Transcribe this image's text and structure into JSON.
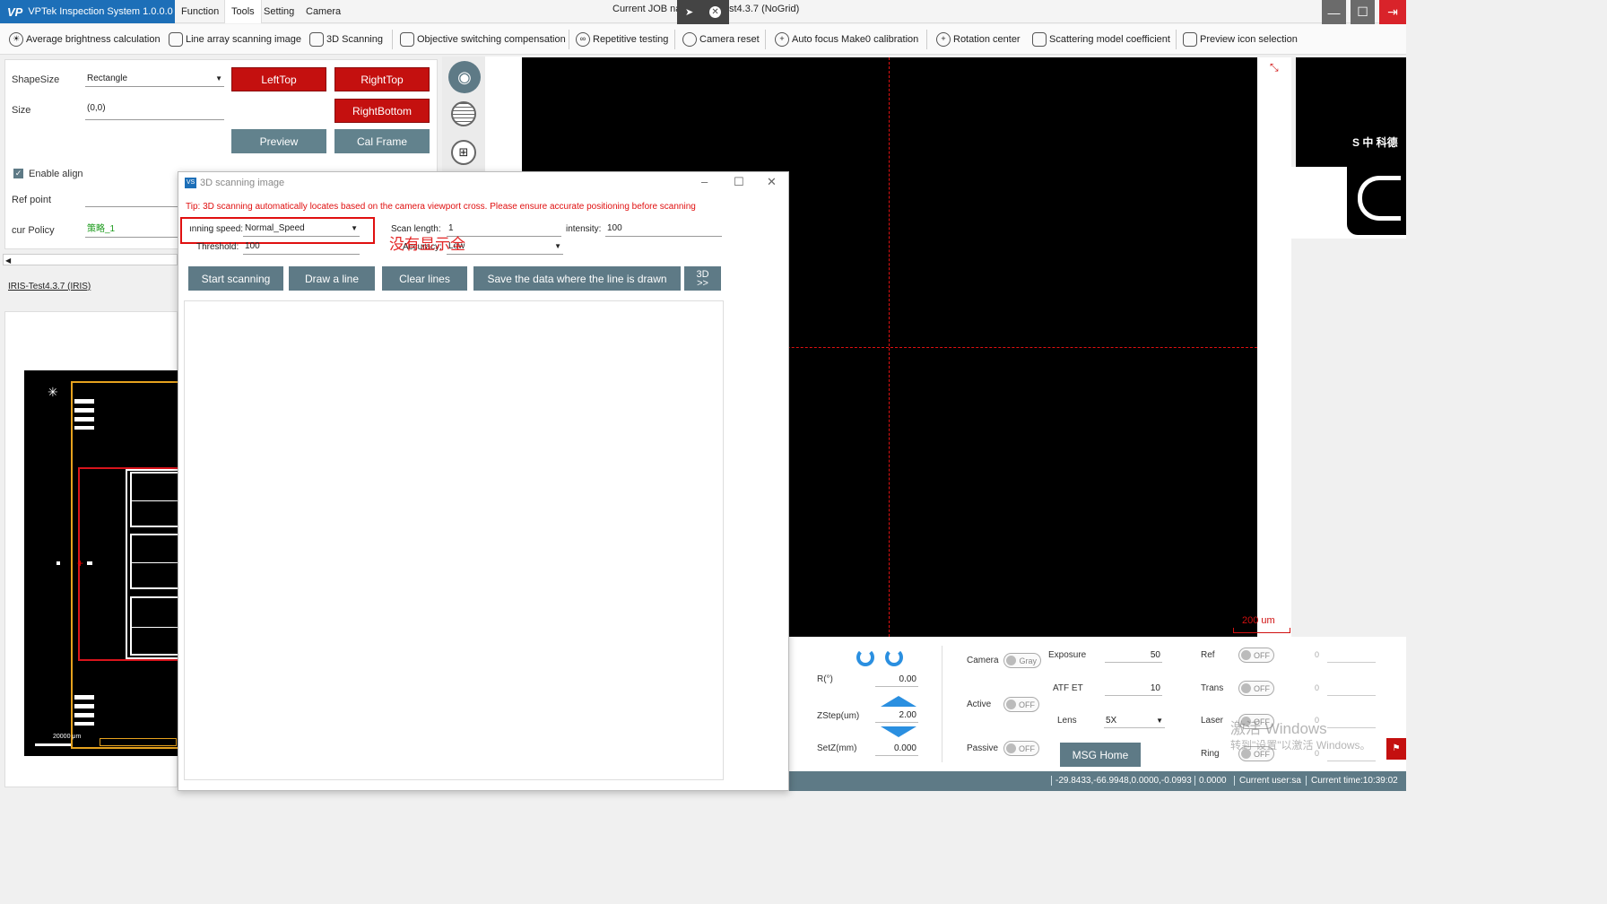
{
  "app": {
    "logo": "VP",
    "title": "VPTek Inspection System 1.0.0.0",
    "job_prefix": "Current JOB na",
    "job_suffix": "st4.3.7 (NoGrid)"
  },
  "menus": [
    "Function",
    "Tools",
    "Setting",
    "Camera"
  ],
  "toolbar": [
    "Average brightness calculation",
    "Line array scanning image",
    "3D Scanning",
    "Objective switching compensation",
    "Repetitive testing",
    "Camera reset",
    "Auto focus Make0 calibration",
    "Rotation center",
    "Scattering model coefficient",
    "Preview icon selection"
  ],
  "left": {
    "shape_label": "ShapeSize",
    "shape_value": "Rectangle",
    "size_label": "Size",
    "size_value": "(0,0)",
    "enable_align": "Enable align",
    "ref_point": "Ref point",
    "cur_policy": "cur Policy",
    "cur_policy_value": "策略_1",
    "iris_link": "IRIS-Test4.3.7 (IRIS)",
    "btn_lefttop": "LeftTop",
    "btn_righttop": "RightTop",
    "btn_rightbottom": "RightBottom",
    "btn_preview": "Preview",
    "btn_calframe": "Cal Frame",
    "map_scale": "20000 μm"
  },
  "dialog": {
    "title": "3D scanning image",
    "tip": "Tip: 3D scanning automatically locates based on the camera viewport cross. Please ensure accurate positioning before scanning",
    "speed_label": "ınning speed:",
    "speed_value": "Normal_Speed",
    "scan_length_label": "Scan length:",
    "scan_length_value": "1",
    "intensity_label": "intensity:",
    "intensity_value": "100",
    "threshold_label": "Threshold:",
    "threshold_value": "100",
    "accuracy_label": "Accuracy:",
    "accuracy_value": "Low",
    "annotation": "没有显示全",
    "btn_start": "Start scanning",
    "btn_draw": "Draw a line",
    "btn_clear": "Clear lines",
    "btn_save": "Save the data where the line is drawn",
    "btn_3d": "3D >>"
  },
  "viewer": {
    "scale": "200 um",
    "logo_text": "S 中 科德"
  },
  "controls": {
    "r_label": "R(°)",
    "r_value": "0.00",
    "zstep_label": "ZStep(um)",
    "zstep_value": "2.00",
    "setz_label": "SetZ(mm)",
    "setz_value": "0.000",
    "camera_label": "Camera",
    "camera_toggle": "Gray",
    "active_label": "Active",
    "active_toggle": "OFF",
    "passive_label": "Passive",
    "passive_toggle": "OFF",
    "exposure_label": "Exposure",
    "exposure_value": "50",
    "atf_label": "ATF ET",
    "atf_value": "10",
    "lens_label": "Lens",
    "lens_value": "5X",
    "msg_home": "MSG Home",
    "ref_label": "Ref",
    "ref_toggle": "OFF",
    "ref_value": "0",
    "trans_label": "Trans",
    "trans_toggle": "OFF",
    "trans_value": "0",
    "laser_label": "Laser",
    "laser_toggle": "OFF",
    "laser_value": "0",
    "ring_label": "Ring",
    "ring_toggle": "OFF",
    "ring_value": "0"
  },
  "watermark": {
    "line1": "激活 Windows",
    "line2": "转到\"设置\"以激活 Windows。"
  },
  "status": {
    "coords": "-29.8433,-66.9948,0.0000,-0.0993",
    "z": "0.0000",
    "user": "Current user:sa",
    "time": "Current time:10:39:02"
  }
}
